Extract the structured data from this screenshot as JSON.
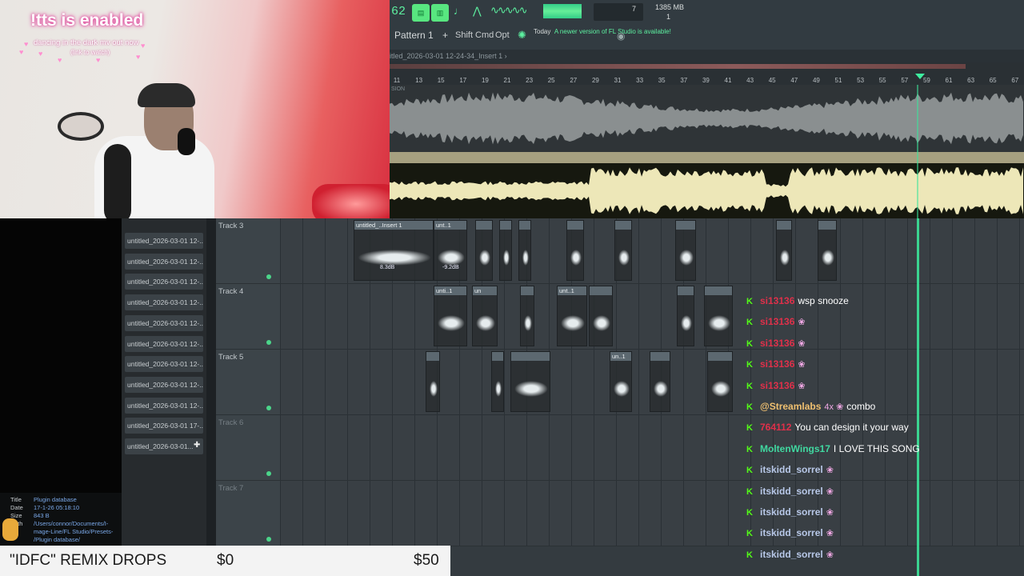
{
  "overlay": {
    "tts_title": "!tts is enabled",
    "song_line": "dancing in the dark mv out now",
    "song_sub": "(link to watch)"
  },
  "fl": {
    "tempo": "62",
    "cpu_num": "7",
    "memory": "1385 MB",
    "voices": "1",
    "pattern": "Pattern 1",
    "plus": "+",
    "keys": [
      "Shift",
      "Cmd",
      "Opt"
    ],
    "news_today": "Today",
    "news_text": "A newer version of FL Studio is available!",
    "window_title": "itled_2026-03-01 12-24-34_Insert 1 ›",
    "wave_label": "SION",
    "ruler": [
      "11",
      "13",
      "15",
      "17",
      "19",
      "21",
      "23",
      "25",
      "27",
      "29",
      "31",
      "33",
      "35",
      "37",
      "39",
      "41",
      "43",
      "45",
      "47",
      "49",
      "51",
      "53",
      "55",
      "57",
      "59",
      "61",
      "63",
      "65",
      "67"
    ]
  },
  "browser": {
    "files": [
      "untitled_2026-03-01 12-...",
      "untitled_2026-03-01 12-...",
      "untitled_2026-03-01 12-...",
      "untitled_2026-03-01 12-...",
      "untitled_2026-03-01 12-...",
      "untitled_2026-03-01 12-...",
      "untitled_2026-03-01 12-...",
      "untitled_2026-03-01 12-...",
      "untitled_2026-03-01 12-...",
      "untitled_2026-03-01 17-...",
      "untitled_2026-03-01..."
    ],
    "info": {
      "title_k": "Title",
      "title_v": "Plugin database",
      "date_k": "Date",
      "date_v": "17-1-26 05:18:10",
      "size_k": "Size",
      "size_v": "843 B",
      "path_k": "Path",
      "path_v1": "/Users/connor/Documents/I-",
      "path_v2": "mage-Line/FL Studio/Presets-",
      "path_v3": "/Plugin database/"
    }
  },
  "tracks": [
    {
      "name": "Track 3",
      "dim": false
    },
    {
      "name": "Track 4",
      "dim": false
    },
    {
      "name": "Track 5",
      "dim": false
    },
    {
      "name": "Track 6",
      "dim": true
    },
    {
      "name": "Track 7",
      "dim": true
    }
  ],
  "clips": {
    "t3": [
      "untitled_..Insert 1",
      "unt..1",
      "",
      "",
      "",
      "",
      "",
      "",
      "",
      ""
    ],
    "t3_db": [
      "8.3dB",
      "-9.2dB"
    ],
    "t4": [
      "unti..1",
      "un",
      "",
      "unt..1",
      "",
      "",
      "",
      "unt..1"
    ],
    "t5": [
      "",
      "",
      "",
      "un..1",
      "",
      "",
      "un..1"
    ]
  },
  "chat": [
    {
      "user": "si13136",
      "color": "#e0304a",
      "text": "wsp snooze",
      "emote": ""
    },
    {
      "user": "si13136",
      "color": "#e0304a",
      "text": "",
      "emote": "❀"
    },
    {
      "user": "si13136",
      "color": "#e0304a",
      "text": "",
      "emote": "❀"
    },
    {
      "user": "si13136",
      "color": "#e0304a",
      "text": "",
      "emote": "❀"
    },
    {
      "user": "si13136",
      "color": "#e0304a",
      "text": "",
      "emote": "❀"
    },
    {
      "user": "@Streamlabs",
      "color": "#f0c070",
      "text": "combo",
      "emote": "4x ❀"
    },
    {
      "user": "764112",
      "color": "#e0304a",
      "text": "You can design it your way",
      "emote": ""
    },
    {
      "user": "MoltenWings17",
      "color": "#40d8a0",
      "text": "I LOVE THIS SONG",
      "emote": ""
    },
    {
      "user": "itskidd_sorrel",
      "color": "#b8c8e8",
      "text": "",
      "emote": "❀"
    },
    {
      "user": "itskidd_sorrel",
      "color": "#b8c8e8",
      "text": "",
      "emote": "❀"
    },
    {
      "user": "itskidd_sorrel",
      "color": "#b8c8e8",
      "text": "",
      "emote": "❀"
    },
    {
      "user": "itskidd_sorrel",
      "color": "#b8c8e8",
      "text": "",
      "emote": "❀"
    },
    {
      "user": "itskidd_sorrel",
      "color": "#b8c8e8",
      "text": "",
      "emote": "❀"
    }
  ],
  "chat_badge": "K",
  "drops": {
    "title": "\"IDFC\" REMIX DROPS",
    "current": "$0",
    "goal": "$50"
  }
}
